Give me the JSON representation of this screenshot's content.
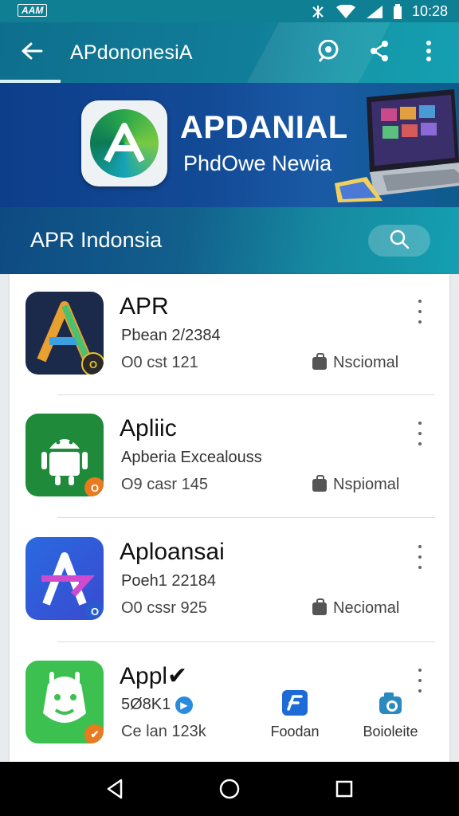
{
  "status_bar": {
    "time": "10:28",
    "badge": "AAM",
    "icons": [
      "nfc-icon",
      "wifi-icon",
      "signal-icon",
      "battery-icon"
    ]
  },
  "app_bar": {
    "title": "APdononesiA",
    "icons": [
      "back-arrow-icon",
      "eye-icon",
      "share-icon",
      "more-vert-icon"
    ]
  },
  "banner": {
    "title": "APDANIAL",
    "subtitle": "PhdOwe Newia"
  },
  "search_bar": {
    "title": "APR Indonsia",
    "icon": "search-icon"
  },
  "apps": [
    {
      "name": "APR",
      "subtitle": "Pbean 2/2384",
      "stat": "O0 cst 121",
      "category": "Nsciomal",
      "icon": "apr-logo-icon",
      "badge": "O"
    },
    {
      "name": "Apliic",
      "subtitle": "Apberia Excealouss",
      "stat": "O9 casr 145",
      "category": "Nspiomal",
      "icon": "android-icon",
      "badge": "O"
    },
    {
      "name": "Aploansai",
      "subtitle": "Poeh1 22184",
      "stat": "O0 cssr 925",
      "category": "Neciomal",
      "icon": "aploansai-logo-icon",
      "badge": "O"
    },
    {
      "name": "Appl✔",
      "subtitle": "5Ø8K1",
      "stat": "Ce lan 123k",
      "category": "",
      "icon": "robot-face-icon",
      "badge": "✔"
    }
  ],
  "quick_actions": [
    {
      "label": "Foodan",
      "icon": "foodan-app-icon"
    },
    {
      "label": "Boioleite",
      "icon": "camera-app-icon"
    }
  ],
  "colors": {
    "primary": "#0f7f94",
    "banner": "#134a96",
    "accent": "#14a0b0"
  }
}
